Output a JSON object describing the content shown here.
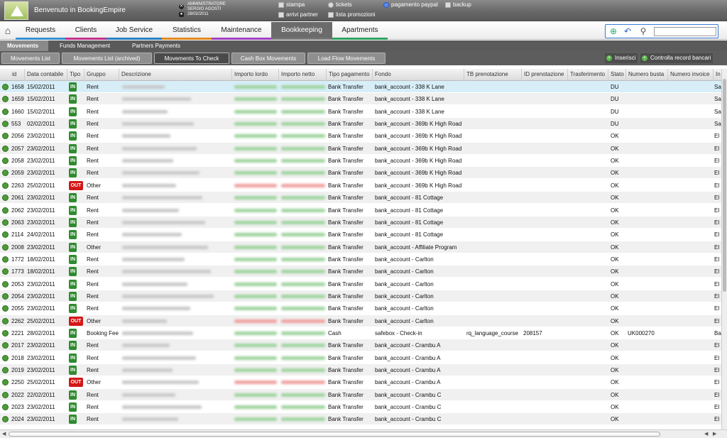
{
  "header": {
    "title": "Benvenuto in BookingEmpire",
    "user_role": "AMMINISTRATORE",
    "user_name": "SERGIO AGOSTI",
    "user_date": "28/02/2011",
    "links": {
      "stampa": "stampa",
      "arrivi": "arrivi partner",
      "tickets": "tickets",
      "promo": "lista promozioni",
      "paypal": "pagamento paypal",
      "backup": "backup"
    }
  },
  "menu": {
    "tabs": [
      "Requests",
      "Clients",
      "Job Service",
      "Statistics",
      "Maintenance",
      "Bookkeeping",
      "Apartments"
    ],
    "active": "Bookkeeping"
  },
  "submenu": {
    "tabs": [
      "Movements",
      "Funds Management",
      "Partners Payments"
    ],
    "active": "Movements"
  },
  "subsubmenu": {
    "tabs": [
      "Movements List",
      "Movements List (archived)",
      "Movements To Check",
      "Cash Box Movements",
      "Load Flow Movements"
    ],
    "active": "Movements To Check"
  },
  "actions": {
    "insert": "Inserisci",
    "check": "Controlla record bancari"
  },
  "table": {
    "columns": [
      "id",
      "Data contabile",
      "Tipo",
      "Gruppo",
      "Descrizione",
      "Importo lordo",
      "Importo netto",
      "Tipo pagamento",
      "Fondo",
      "TB prenotazione",
      "ID prenotazione",
      "Trasferimento",
      "Stato",
      "Numero busta",
      "Numero invoice",
      "In"
    ],
    "rows": [
      {
        "id": "1658",
        "date": "15/02/2011",
        "tipo": "IN",
        "gruppo": "Rent",
        "pay": "Bank Transfer",
        "fondo": "bank_account - 338 K Lane",
        "tb": "",
        "idp": "",
        "stato": "DU",
        "busta": "",
        "last": "Sa"
      },
      {
        "id": "1659",
        "date": "15/02/2011",
        "tipo": "IN",
        "gruppo": "Rent",
        "pay": "Bank Transfer",
        "fondo": "bank_account - 338 K Lane",
        "tb": "",
        "idp": "",
        "stato": "DU",
        "busta": "",
        "last": "Sa"
      },
      {
        "id": "1660",
        "date": "15/02/2011",
        "tipo": "IN",
        "gruppo": "Rent",
        "pay": "Bank Transfer",
        "fondo": "bank_account - 338 K Lane",
        "tb": "",
        "idp": "",
        "stato": "DU",
        "busta": "",
        "last": "Sa"
      },
      {
        "id": "553",
        "date": "02/02/2011",
        "tipo": "IN",
        "gruppo": "Rent",
        "pay": "Bank Transfer",
        "fondo": "bank_account - 369b K High Road",
        "tb": "",
        "idp": "",
        "stato": "DU",
        "busta": "",
        "last": "Sa"
      },
      {
        "id": "2056",
        "date": "23/02/2011",
        "tipo": "IN",
        "gruppo": "Rent",
        "pay": "Bank Transfer",
        "fondo": "bank_account - 369b K High Road",
        "tb": "",
        "idp": "",
        "stato": "OK",
        "busta": "",
        "last": "El"
      },
      {
        "id": "2057",
        "date": "23/02/2011",
        "tipo": "IN",
        "gruppo": "Rent",
        "pay": "Bank Transfer",
        "fondo": "bank_account - 369b K High Road",
        "tb": "",
        "idp": "",
        "stato": "OK",
        "busta": "",
        "last": "El"
      },
      {
        "id": "2058",
        "date": "23/02/2011",
        "tipo": "IN",
        "gruppo": "Rent",
        "pay": "Bank Transfer",
        "fondo": "bank_account - 369b K High Road",
        "tb": "",
        "idp": "",
        "stato": "OK",
        "busta": "",
        "last": "El"
      },
      {
        "id": "2059",
        "date": "23/02/2011",
        "tipo": "IN",
        "gruppo": "Rent",
        "pay": "Bank Transfer",
        "fondo": "bank_account - 369b K High Road",
        "tb": "",
        "idp": "",
        "stato": "OK",
        "busta": "",
        "last": "El"
      },
      {
        "id": "2263",
        "date": "25/02/2011",
        "tipo": "OUT",
        "gruppo": "Other",
        "pay": "Bank Transfer",
        "fondo": "bank_account - 369b K High Road",
        "tb": "",
        "idp": "",
        "stato": "OK",
        "busta": "",
        "last": "El"
      },
      {
        "id": "2061",
        "date": "23/02/2011",
        "tipo": "IN",
        "gruppo": "Rent",
        "pay": "Bank Transfer",
        "fondo": "bank_account - 81 Cottage",
        "tb": "",
        "idp": "",
        "stato": "OK",
        "busta": "",
        "last": "El"
      },
      {
        "id": "2062",
        "date": "23/02/2011",
        "tipo": "IN",
        "gruppo": "Rent",
        "pay": "Bank Transfer",
        "fondo": "bank_account - 81 Cottage",
        "tb": "",
        "idp": "",
        "stato": "OK",
        "busta": "",
        "last": "El"
      },
      {
        "id": "2063",
        "date": "23/02/2011",
        "tipo": "IN",
        "gruppo": "Rent",
        "pay": "Bank Transfer",
        "fondo": "bank_account - 81 Cottage",
        "tb": "",
        "idp": "",
        "stato": "OK",
        "busta": "",
        "last": "El"
      },
      {
        "id": "2114",
        "date": "24/02/2011",
        "tipo": "IN",
        "gruppo": "Rent",
        "pay": "Bank Transfer",
        "fondo": "bank_account - 81 Cottage",
        "tb": "",
        "idp": "",
        "stato": "OK",
        "busta": "",
        "last": "El"
      },
      {
        "id": "2008",
        "date": "23/02/2011",
        "tipo": "IN",
        "gruppo": "Other",
        "pay": "Bank Transfer",
        "fondo": "bank_account - Affiliate Program",
        "tb": "",
        "idp": "",
        "stato": "OK",
        "busta": "",
        "last": "El"
      },
      {
        "id": "1772",
        "date": "18/02/2011",
        "tipo": "IN",
        "gruppo": "Rent",
        "pay": "Bank Transfer",
        "fondo": "bank_account - Carlton",
        "tb": "",
        "idp": "",
        "stato": "OK",
        "busta": "",
        "last": "El"
      },
      {
        "id": "1773",
        "date": "18/02/2011",
        "tipo": "IN",
        "gruppo": "Rent",
        "pay": "Bank Transfer",
        "fondo": "bank_account - Carlton",
        "tb": "",
        "idp": "",
        "stato": "OK",
        "busta": "",
        "last": "El"
      },
      {
        "id": "2053",
        "date": "23/02/2011",
        "tipo": "IN",
        "gruppo": "Rent",
        "pay": "Bank Transfer",
        "fondo": "bank_account - Carlton",
        "tb": "",
        "idp": "",
        "stato": "OK",
        "busta": "",
        "last": "El"
      },
      {
        "id": "2054",
        "date": "23/02/2011",
        "tipo": "IN",
        "gruppo": "Rent",
        "pay": "Bank Transfer",
        "fondo": "bank_account - Carlton",
        "tb": "",
        "idp": "",
        "stato": "OK",
        "busta": "",
        "last": "El"
      },
      {
        "id": "2055",
        "date": "23/02/2011",
        "tipo": "IN",
        "gruppo": "Rent",
        "pay": "Bank Transfer",
        "fondo": "bank_account - Carlton",
        "tb": "",
        "idp": "",
        "stato": "OK",
        "busta": "",
        "last": "El"
      },
      {
        "id": "2262",
        "date": "25/02/2011",
        "tipo": "OUT",
        "gruppo": "Other",
        "pay": "Bank Transfer",
        "fondo": "bank_account - Carlton",
        "tb": "",
        "idp": "",
        "stato": "OK",
        "busta": "",
        "last": "El"
      },
      {
        "id": "2221",
        "date": "28/02/2011",
        "tipo": "IN",
        "gruppo": "Booking Fee",
        "pay": "Cash",
        "fondo": "safebox - Check-in",
        "tb": "rq_language_course",
        "idp": "208157",
        "stato": "OK",
        "busta": "UK000270",
        "last": "Ba"
      },
      {
        "id": "2017",
        "date": "23/02/2011",
        "tipo": "IN",
        "gruppo": "Rent",
        "pay": "Bank Transfer",
        "fondo": "bank_account - Crambu A",
        "tb": "",
        "idp": "",
        "stato": "OK",
        "busta": "",
        "last": "El"
      },
      {
        "id": "2018",
        "date": "23/02/2011",
        "tipo": "IN",
        "gruppo": "Rent",
        "pay": "Bank Transfer",
        "fondo": "bank_account - Crambu A",
        "tb": "",
        "idp": "",
        "stato": "OK",
        "busta": "",
        "last": "El"
      },
      {
        "id": "2019",
        "date": "23/02/2011",
        "tipo": "IN",
        "gruppo": "Rent",
        "pay": "Bank Transfer",
        "fondo": "bank_account - Crambu A",
        "tb": "",
        "idp": "",
        "stato": "OK",
        "busta": "",
        "last": "El"
      },
      {
        "id": "2250",
        "date": "25/02/2011",
        "tipo": "OUT",
        "gruppo": "Other",
        "pay": "Bank Transfer",
        "fondo": "bank_account - Crambu A",
        "tb": "",
        "idp": "",
        "stato": "OK",
        "busta": "",
        "last": "El"
      },
      {
        "id": "2022",
        "date": "22/02/2011",
        "tipo": "IN",
        "gruppo": "Rent",
        "pay": "Bank Transfer",
        "fondo": "bank_account - Crambu C",
        "tb": "",
        "idp": "",
        "stato": "OK",
        "busta": "",
        "last": "El"
      },
      {
        "id": "2023",
        "date": "23/02/2011",
        "tipo": "IN",
        "gruppo": "Rent",
        "pay": "Bank Transfer",
        "fondo": "bank_account - Crambu C",
        "tb": "",
        "idp": "",
        "stato": "OK",
        "busta": "",
        "last": "El"
      },
      {
        "id": "2024",
        "date": "23/02/2011",
        "tipo": "IN",
        "gruppo": "Rent",
        "pay": "Bank Transfer",
        "fondo": "bank_account - Crambu C",
        "tb": "",
        "idp": "",
        "stato": "OK",
        "busta": "",
        "last": "El"
      }
    ]
  },
  "colors": {
    "in": "#2e8b2e",
    "out": "#d21818",
    "selected_row": "#d7eef8",
    "header_bg": "#666666"
  }
}
